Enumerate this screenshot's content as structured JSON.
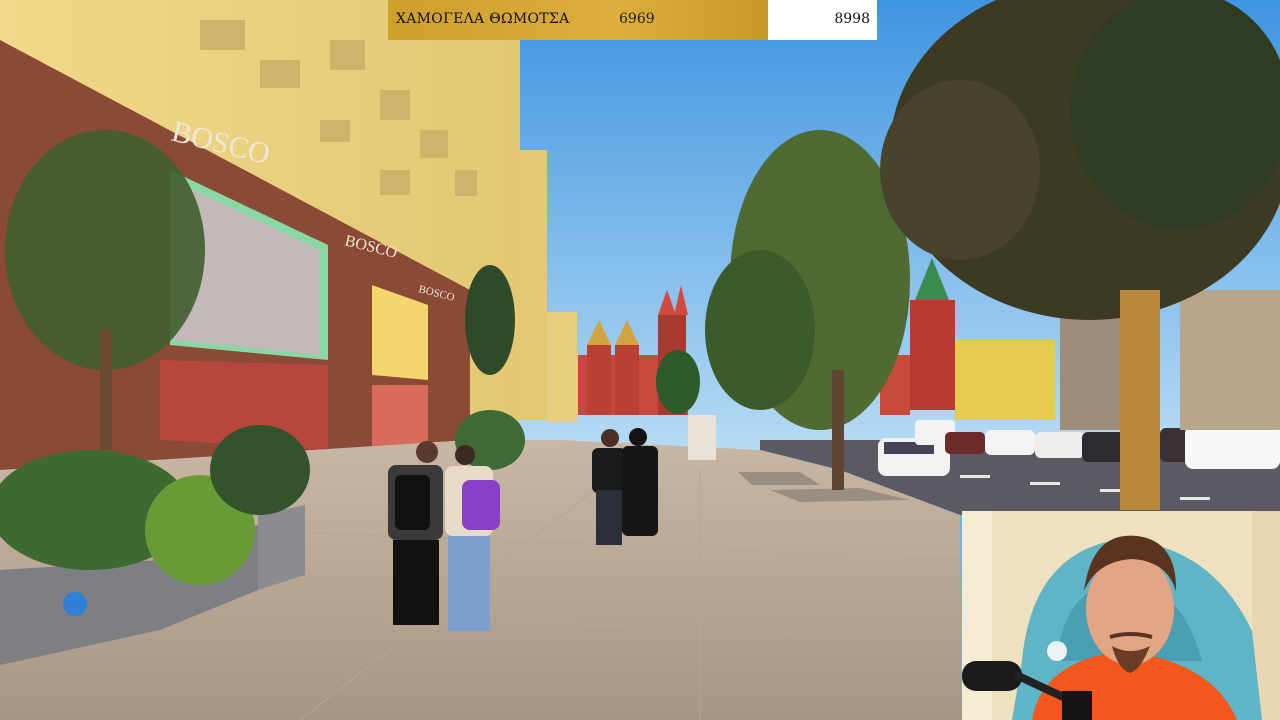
{
  "overlay": {
    "title": "ΧΑΜΟΓΕΛΑ ΘΩΜΟΤΣΑ",
    "current_count": "6969",
    "goal_count": "8998"
  },
  "scene": {
    "shop_sign": "BOSCO",
    "shop_sign_small": "BOSCO",
    "shop_sign_side": "BOSCO"
  },
  "colors": {
    "overlay_gold": "#d4a533",
    "overlay_white": "#ffffff",
    "sky": "#5fa8e6",
    "chair_teal": "#5fb4c6",
    "shirt_orange": "#f2581e"
  }
}
